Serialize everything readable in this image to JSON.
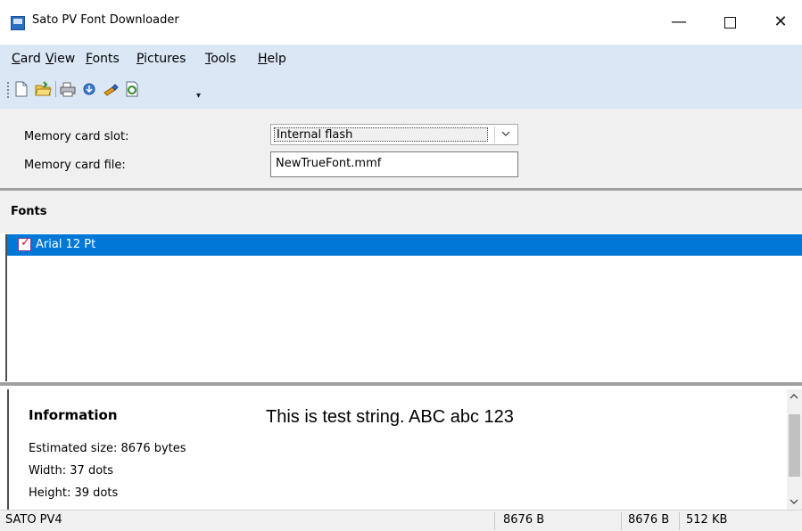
{
  "window": {
    "title": "Sato PV Font Downloader",
    "minimize": "—",
    "close": "✕"
  },
  "menu": [
    {
      "label": "Card",
      "first": "C",
      "rest": "ard"
    },
    {
      "label": "View",
      "first": "V",
      "rest": "iew"
    },
    {
      "label": "Fonts",
      "first": "F",
      "rest": "onts"
    },
    {
      "label": "Pictures",
      "first": "P",
      "rest": "ictures"
    },
    {
      "label": "Tools",
      "first": "T",
      "rest": "ools"
    },
    {
      "label": "Help",
      "first": "H",
      "rest": "elp"
    }
  ],
  "toolbar": {
    "icons": [
      "new-file-icon",
      "open-folder-icon",
      "print-icon",
      "download-icon",
      "wand-icon",
      "refresh-icon"
    ],
    "overflow": "▾"
  },
  "memory": {
    "slot_label": "Memory card slot:",
    "slot_value": "Internal flash",
    "file_label": "Memory card file:",
    "file_value": "NewTrueFont.mmf"
  },
  "fonts": {
    "header": "Fonts",
    "items": [
      "Arial 12 Pt"
    ]
  },
  "info": {
    "title": "Information",
    "estimated_size": "Estimated size: 8676 bytes",
    "width": "Width: 37 dots",
    "height": "Height: 39 dots",
    "test_string": "This is test string. ABC abc 123"
  },
  "status": {
    "printer": "SATO PV4",
    "size1": "8676 B",
    "size2": "8676 B",
    "capacity": "512 KB"
  },
  "colors": {
    "band": "#dbe7f5",
    "selection": "#0078d7"
  }
}
